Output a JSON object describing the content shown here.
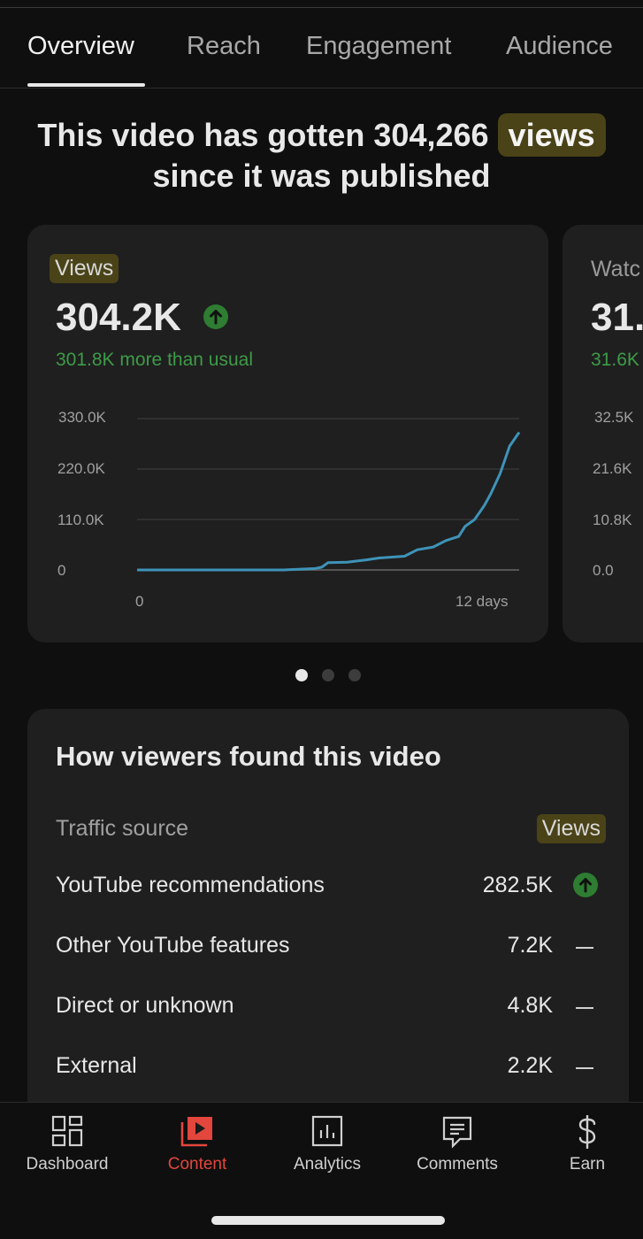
{
  "tabs": [
    {
      "label": "Overview"
    },
    {
      "label": "Reach"
    },
    {
      "label": "Engagement"
    },
    {
      "label": "Audience"
    }
  ],
  "headline": {
    "prefix": "This video has gotten 304,266",
    "highlight": "views",
    "suffix": "since it was published"
  },
  "views_card": {
    "label": "Views",
    "value": "304.2K",
    "trend_icon": "arrow-up-circle-icon",
    "comparison": "301.8K more than usual"
  },
  "chart_data": {
    "type": "line",
    "title": "",
    "xlabel": "",
    "ylabel": "",
    "x_tick_labels": [
      "0",
      "12 days"
    ],
    "y_tick_labels": [
      "330.0K",
      "220.0K",
      "110.0K",
      "0"
    ],
    "ylim": [
      0,
      330000
    ],
    "xlim": [
      0,
      12
    ],
    "grid": true,
    "color": "#3e93b8",
    "series": [
      {
        "x": [
          0,
          4.6,
          5.6,
          5.8,
          6.0,
          6.6,
          7.2,
          7.6,
          8.4,
          8.8,
          9.3,
          9.7,
          10.1,
          10.3,
          10.6,
          10.9,
          11.1,
          11.4,
          11.7,
          12.0
        ],
        "y": [
          0,
          0,
          3000,
          6000,
          16000,
          17000,
          22000,
          26000,
          30000,
          44000,
          50000,
          64000,
          73000,
          95000,
          110000,
          140000,
          165000,
          210000,
          270000,
          300000
        ]
      }
    ]
  },
  "watch_card": {
    "label": "Watc",
    "value": "31.",
    "comparison": "31.6K",
    "y_tick_labels": [
      "32.5K",
      "21.6K",
      "10.8K",
      "0.0"
    ]
  },
  "carousel": {
    "count": 3,
    "active_index": 0
  },
  "traffic": {
    "title": "How viewers found this video",
    "column_source": "Traffic source",
    "column_views": "Views",
    "rows": [
      {
        "source": "YouTube recommendations",
        "views": "282.5K",
        "trend": "up"
      },
      {
        "source": "Other YouTube features",
        "views": "7.2K",
        "trend": "flat"
      },
      {
        "source": "Direct or unknown",
        "views": "4.8K",
        "trend": "flat"
      },
      {
        "source": "External",
        "views": "2.2K",
        "trend": "flat"
      }
    ]
  },
  "bottom_nav": [
    {
      "label": "Dashboard",
      "icon": "dashboard-icon"
    },
    {
      "label": "Content",
      "icon": "content-icon",
      "active": true
    },
    {
      "label": "Analytics",
      "icon": "analytics-icon"
    },
    {
      "label": "Comments",
      "icon": "comments-icon"
    },
    {
      "label": "Earn",
      "icon": "dollar-icon"
    }
  ],
  "colors": {
    "background": "#0f0f0f",
    "card": "#1f1f1f",
    "highlight": "#4a4318",
    "positive": "#3e9b48",
    "active_nav": "#e2463c",
    "line": "#3e93b8"
  }
}
